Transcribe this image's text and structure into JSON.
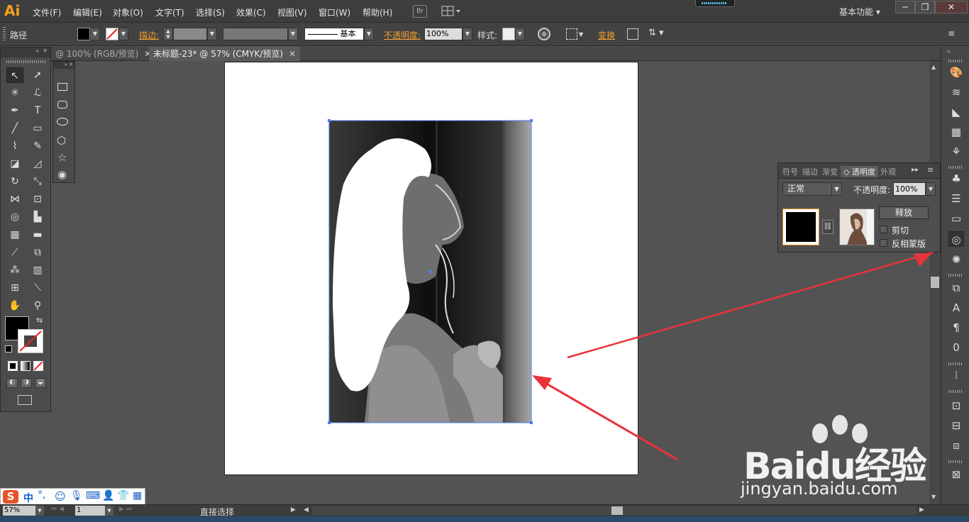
{
  "app": {
    "logo": "Ai"
  },
  "menu": [
    "文件(F)",
    "编辑(E)",
    "对象(O)",
    "文字(T)",
    "选择(S)",
    "效果(C)",
    "视图(V)",
    "窗口(W)",
    "帮助(H)"
  ],
  "bridge_label": "Br",
  "workspace": {
    "label": "基本功能",
    "caret": "▾"
  },
  "window_controls": {
    "minimize": "─",
    "restore": "❐",
    "close": "✕"
  },
  "control_bar": {
    "selection_label": "路径",
    "stroke_label": "描边",
    "stroke_style_label": "基本",
    "opacity_label": "不透明度",
    "opacity_value": "100%",
    "style_label": "样式",
    "transform_label": "变换"
  },
  "tabs": [
    {
      "label": "@ 100% (RGB/预览)",
      "close": "✕"
    },
    {
      "label": "未标题-23* @ 57% (CMYK/预览)",
      "close": "✕"
    }
  ],
  "transparency_panel": {
    "tabs": [
      "符号",
      "描边",
      "渐变",
      "透明度",
      "外观"
    ],
    "active_tab": "透明度",
    "blend_mode": "正常",
    "opacity_label": "不透明度:",
    "opacity_value": "100%",
    "release_button": "释放",
    "clip_label": "剪切",
    "invert_label": "反相蒙版"
  },
  "status": {
    "zoom": "57%",
    "page": "1",
    "tool": "直接选择"
  },
  "ime": {
    "mode": "中",
    "punct": "°,"
  },
  "watermark": {
    "brand": "Baidu经验",
    "url": "jingyan.baidu.com"
  },
  "colors": {
    "accent_orange": "#f0a030",
    "arrow_red": "#e8333a",
    "selection_blue": "#4a7cf0"
  }
}
